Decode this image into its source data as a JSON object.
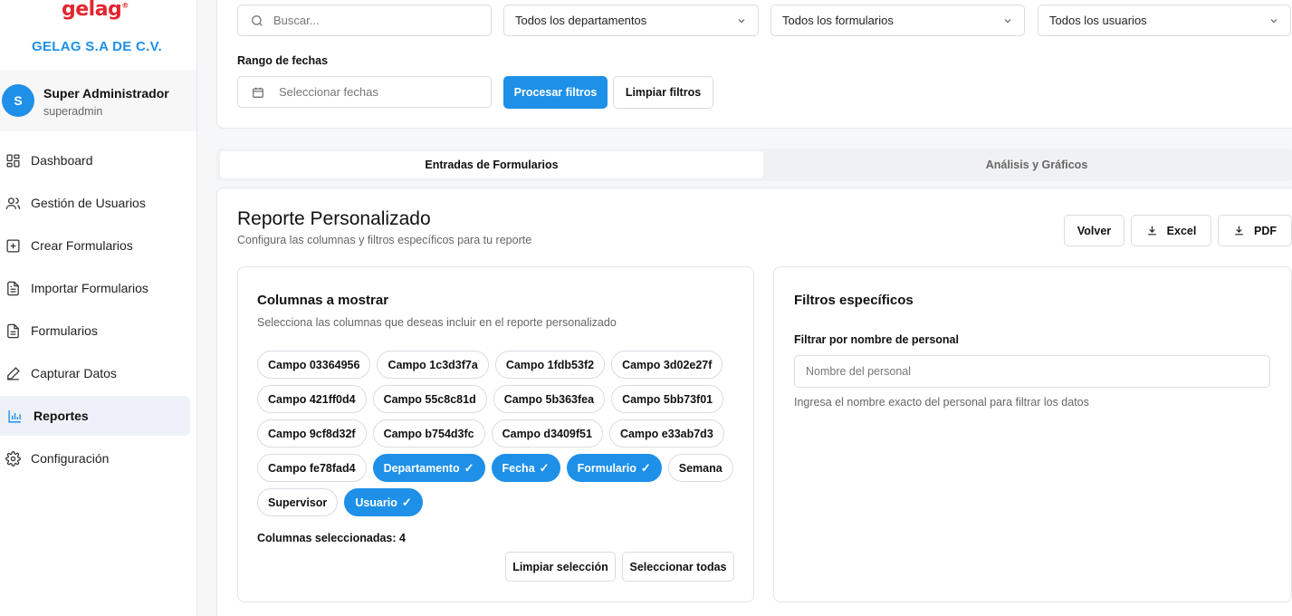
{
  "brand": {
    "logo": "gelag",
    "logo_mark": "®",
    "company": "GELAG S.A DE C.V."
  },
  "user": {
    "initial": "S",
    "name": "Super Administrador",
    "role": "superadmin"
  },
  "nav": [
    {
      "label": "Dashboard",
      "icon": "dashboard-icon"
    },
    {
      "label": "Gestión de Usuarios",
      "icon": "users-icon"
    },
    {
      "label": "Crear Formularios",
      "icon": "plus-square-icon"
    },
    {
      "label": "Importar Formularios",
      "icon": "file-import-icon"
    },
    {
      "label": "Formularios",
      "icon": "file-text-icon"
    },
    {
      "label": "Capturar Datos",
      "icon": "pen-icon"
    },
    {
      "label": "Reportes",
      "icon": "bar-chart-icon",
      "active": true
    },
    {
      "label": "Configuración",
      "icon": "gear-icon"
    }
  ],
  "filters": {
    "search_placeholder": "Buscar...",
    "department": "Todos los departamentos",
    "form": "Todos los formularios",
    "users": "Todos los usuarios",
    "date_range_label": "Rango de fechas",
    "date_placeholder": "Seleccionar fechas",
    "process_label": "Procesar filtros",
    "clear_label": "Limpiar filtros"
  },
  "tabs": [
    {
      "label": "Entradas de Formularios",
      "active": true
    },
    {
      "label": "Análisis y Gráficos",
      "active": false
    }
  ],
  "report": {
    "title": "Reporte Personalizado",
    "subtitle": "Configura las columnas y filtros específicos para tu reporte",
    "back_label": "Volver",
    "excel_label": "Excel",
    "pdf_label": "PDF"
  },
  "columns": {
    "title": "Columnas a mostrar",
    "subtitle": "Selecciona las columnas que deseas incluir en el reporte personalizado",
    "chips": [
      {
        "label": "Campo 03364956",
        "selected": false
      },
      {
        "label": "Campo 1c3d3f7a",
        "selected": false
      },
      {
        "label": "Campo 1fdb53f2",
        "selected": false
      },
      {
        "label": "Campo 3d02e27f",
        "selected": false
      },
      {
        "label": "Campo 421ff0d4",
        "selected": false
      },
      {
        "label": "Campo 55c8c81d",
        "selected": false
      },
      {
        "label": "Campo 5b363fea",
        "selected": false
      },
      {
        "label": "Campo 5bb73f01",
        "selected": false
      },
      {
        "label": "Campo 9cf8d32f",
        "selected": false
      },
      {
        "label": "Campo b754d3fc",
        "selected": false
      },
      {
        "label": "Campo d3409f51",
        "selected": false
      },
      {
        "label": "Campo e33ab7d3",
        "selected": false
      },
      {
        "label": "Campo fe78fad4",
        "selected": false
      },
      {
        "label": "Departamento",
        "selected": true
      },
      {
        "label": "Fecha",
        "selected": true
      },
      {
        "label": "Formulario",
        "selected": true
      },
      {
        "label": "Semana",
        "selected": false
      },
      {
        "label": "Supervisor",
        "selected": false
      },
      {
        "label": "Usuario",
        "selected": true
      }
    ],
    "check_mark": "✓",
    "selected_count_label": "Columnas seleccionadas: 4",
    "clear_selection_label": "Limpiar selección",
    "select_all_label": "Seleccionar todas"
  },
  "specific_filters": {
    "title": "Filtros específicos",
    "name_label": "Filtrar por nombre de personal",
    "name_placeholder": "Nombre del personal",
    "help": "Ingresa el nombre exacto del personal para filtrar los datos"
  },
  "colors": {
    "accent": "#1e90e8",
    "brand": "#e3262e"
  }
}
